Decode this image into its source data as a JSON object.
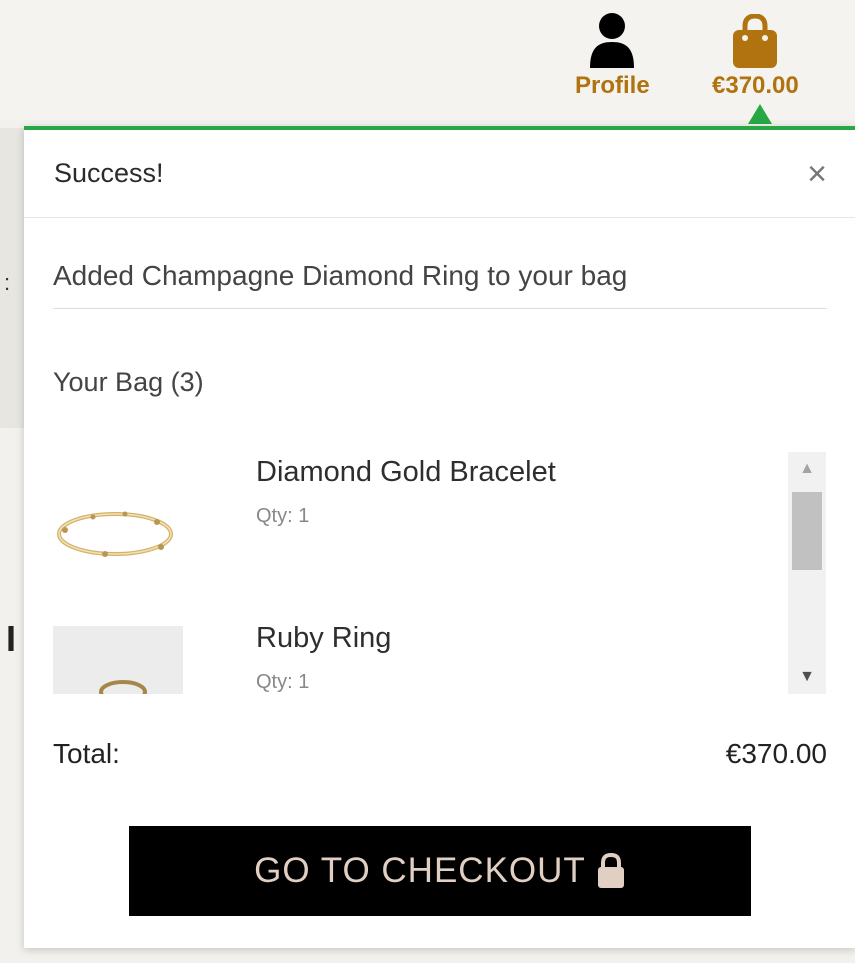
{
  "header": {
    "profile_label": "Profile",
    "bag_total": "€370.00",
    "accent_color": "#b0730f"
  },
  "toast": {
    "title": "Success!",
    "close_symbol": "×",
    "message": "Added Champagne Diamond Ring to your bag",
    "status_color": "#28a745"
  },
  "bag": {
    "heading": "Your Bag (3)",
    "items": [
      {
        "name": "Diamond Gold Bracelet",
        "qty": "Qty: 1"
      },
      {
        "name": "Ruby Ring",
        "qty": "Qty: 1"
      }
    ],
    "total_label": "Total:",
    "total_value": "€370.00"
  },
  "checkout": {
    "label": "GO TO CHECKOUT",
    "icon": "lock-icon"
  },
  "background": {
    "glyph_1": ":",
    "glyph_2": "I"
  }
}
